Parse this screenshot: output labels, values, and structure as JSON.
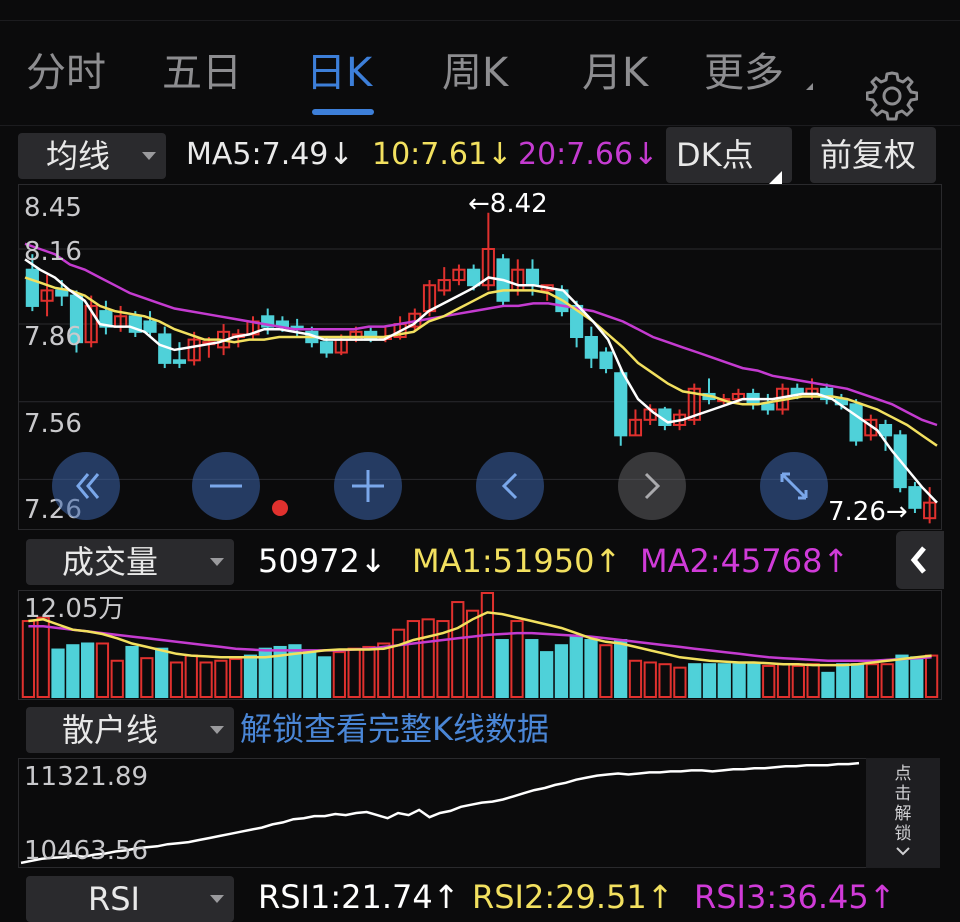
{
  "tabs": [
    {
      "label": "分时"
    },
    {
      "label": "五日"
    },
    {
      "label": "日K"
    },
    {
      "label": "周K"
    },
    {
      "label": "月K"
    },
    {
      "label": "更多"
    }
  ],
  "active_tab": "日K",
  "kline_header": {
    "indicator_dropdown": "均线",
    "ma5": "MA5:7.49↓",
    "ma10": "10:7.61↓",
    "ma20": "20:7.66↓",
    "dk_button": "DK点",
    "adjust_button": "前复权"
  },
  "kline_axis": [
    "8.45",
    "8.16",
    "7.86",
    "7.56",
    "7.26"
  ],
  "kline_annotations": {
    "high": "←8.42",
    "low": "7.26→"
  },
  "volume_header": {
    "indicator_dropdown": "成交量",
    "value": "50972↓",
    "ma1": "MA1:51950↑",
    "ma2": "MA2:45768↑"
  },
  "volume_axis_top": "12.05万",
  "retail_header": {
    "indicator_dropdown": "散户线",
    "unlock_link": "解锁查看完整K线数据"
  },
  "retail_axis": [
    "11321.89",
    "10463.56"
  ],
  "side_unlock": [
    "点",
    "击",
    "解",
    "锁"
  ],
  "rsi_header": {
    "indicator_dropdown": "RSI",
    "rsi1": "RSI1:21.74↑",
    "rsi2": "RSI2:29.51↑",
    "rsi3": "RSI3:36.45↑"
  },
  "colors": {
    "up": "#e0312e",
    "down": "#4fd1d9",
    "ma5": "#ffffff",
    "ma10": "#f2e05f",
    "ma20": "#c43bd0",
    "accent": "#3d7fd9"
  },
  "chart_data": [
    {
      "type": "candlestick",
      "ylim": [
        7.26,
        8.45
      ],
      "candles": [
        [
          8.2,
          8.06,
          8.26,
          8.04
        ],
        [
          8.08,
          8.12,
          8.18,
          8.02
        ],
        [
          8.12,
          8.1,
          8.16,
          8.06
        ],
        [
          8.1,
          7.92,
          8.12,
          7.88
        ],
        [
          7.92,
          8.06,
          8.1,
          7.9
        ],
        [
          8.04,
          7.98,
          8.08,
          7.95
        ],
        [
          7.98,
          8.02,
          8.06,
          7.96
        ],
        [
          8.02,
          7.96,
          8.04,
          7.94
        ],
        [
          8.0,
          7.96,
          8.04,
          7.94
        ],
        [
          7.95,
          7.84,
          7.98,
          7.82
        ],
        [
          7.85,
          7.84,
          7.92,
          7.82
        ],
        [
          7.85,
          7.93,
          7.96,
          7.83
        ],
        [
          7.92,
          7.92,
          7.94,
          7.86
        ],
        [
          7.9,
          7.96,
          7.99,
          7.87
        ],
        [
          7.94,
          7.95,
          7.97,
          7.9
        ],
        [
          7.95,
          8.0,
          8.02,
          7.93
        ],
        [
          8.02,
          7.98,
          8.05,
          7.95
        ],
        [
          8.0,
          7.98,
          8.02,
          7.96
        ],
        [
          7.98,
          7.97,
          8.01,
          7.94
        ],
        [
          7.96,
          7.92,
          7.98,
          7.9
        ],
        [
          7.92,
          7.88,
          7.94,
          7.86
        ],
        [
          7.88,
          7.93,
          7.95,
          7.87
        ],
        [
          7.93,
          7.96,
          7.98,
          7.92
        ],
        [
          7.96,
          7.93,
          7.98,
          7.92
        ],
        [
          7.94,
          7.94,
          7.98,
          7.92
        ],
        [
          7.94,
          7.99,
          8.02,
          7.93
        ],
        [
          7.98,
          8.03,
          8.05,
          7.96
        ],
        [
          8.04,
          8.14,
          8.16,
          8.02
        ],
        [
          8.12,
          8.16,
          8.21,
          8.1
        ],
        [
          8.16,
          8.2,
          8.22,
          8.14
        ],
        [
          8.2,
          8.14,
          8.22,
          8.12
        ],
        [
          8.14,
          8.28,
          8.42,
          8.12
        ],
        [
          8.24,
          8.08,
          8.26,
          8.06
        ],
        [
          8.12,
          8.2,
          8.24,
          8.1
        ],
        [
          8.2,
          8.14,
          8.24,
          8.1
        ],
        [
          8.12,
          8.14,
          8.14,
          8.08
        ],
        [
          8.12,
          8.04,
          8.14,
          8.02
        ],
        [
          8.06,
          7.94,
          8.08,
          7.9
        ],
        [
          7.94,
          7.86,
          7.98,
          7.82
        ],
        [
          7.88,
          7.82,
          7.9,
          7.8
        ],
        [
          7.8,
          7.56,
          7.82,
          7.52
        ],
        [
          7.56,
          7.62,
          7.66,
          7.56
        ],
        [
          7.62,
          7.66,
          7.68,
          7.6
        ],
        [
          7.66,
          7.6,
          7.67,
          7.58
        ],
        [
          7.6,
          7.64,
          7.66,
          7.58
        ],
        [
          7.62,
          7.74,
          7.76,
          7.6
        ],
        [
          7.72,
          7.7,
          7.78,
          7.68
        ],
        [
          7.7,
          7.7,
          7.72,
          7.68
        ],
        [
          7.7,
          7.72,
          7.74,
          7.68
        ],
        [
          7.72,
          7.68,
          7.74,
          7.66
        ],
        [
          7.68,
          7.66,
          7.72,
          7.64
        ],
        [
          7.66,
          7.74,
          7.76,
          7.64
        ],
        [
          7.74,
          7.72,
          7.76,
          7.7
        ],
        [
          7.72,
          7.74,
          7.78,
          7.7
        ],
        [
          7.74,
          7.7,
          7.76,
          7.68
        ],
        [
          7.7,
          7.68,
          7.72,
          7.66
        ],
        [
          7.68,
          7.54,
          7.7,
          7.52
        ],
        [
          7.56,
          7.62,
          7.64,
          7.54
        ],
        [
          7.6,
          7.56,
          7.62,
          7.5
        ],
        [
          7.56,
          7.36,
          7.58,
          7.34
        ],
        [
          7.36,
          7.28,
          7.38,
          7.26
        ],
        [
          7.24,
          7.3,
          7.36,
          7.22
        ]
      ],
      "ma5": [
        8.24,
        8.2,
        8.17,
        8.12,
        8.08,
        7.99,
        7.98,
        7.98,
        7.96,
        7.91,
        7.89,
        7.9,
        7.91,
        7.92,
        7.94,
        7.95,
        7.97,
        7.97,
        7.96,
        7.95,
        7.93,
        7.93,
        7.93,
        7.93,
        7.93,
        7.96,
        7.99,
        8.04,
        8.07,
        8.1,
        8.13,
        8.17,
        8.16,
        8.14,
        8.14,
        8.13,
        8.12,
        8.06,
        8.0,
        7.93,
        7.8,
        7.7,
        7.65,
        7.61,
        7.62,
        7.64,
        7.66,
        7.68,
        7.7,
        7.7,
        7.7,
        7.71,
        7.72,
        7.72,
        7.7,
        7.66,
        7.62,
        7.58,
        7.5,
        7.43,
        7.36,
        7.3
      ],
      "ma10": [
        8.17,
        8.15,
        8.13,
        8.12,
        8.1,
        8.06,
        8.04,
        8.03,
        8.02,
        8.0,
        7.97,
        7.95,
        7.93,
        7.93,
        7.92,
        7.93,
        7.93,
        7.94,
        7.94,
        7.94,
        7.94,
        7.94,
        7.94,
        7.94,
        7.94,
        7.95,
        7.96,
        8.0,
        8.02,
        8.05,
        8.08,
        8.11,
        8.12,
        8.12,
        8.12,
        8.11,
        8.08,
        8.04,
        8.0,
        7.95,
        7.9,
        7.84,
        7.8,
        7.76,
        7.73,
        7.72,
        7.71,
        7.69,
        7.68,
        7.68,
        7.69,
        7.7,
        7.71,
        7.71,
        7.71,
        7.7,
        7.68,
        7.66,
        7.63,
        7.6,
        7.56,
        7.52
      ],
      "ma20": [
        8.3,
        8.28,
        8.26,
        8.22,
        8.2,
        8.17,
        8.14,
        8.11,
        8.09,
        8.07,
        8.05,
        8.04,
        8.03,
        8.02,
        8.01,
        8.0,
        7.99,
        7.98,
        7.97,
        7.97,
        7.97,
        7.97,
        7.97,
        7.98,
        7.98,
        7.99,
        8.0,
        8.01,
        8.02,
        8.03,
        8.04,
        8.05,
        8.06,
        8.06,
        8.07,
        8.07,
        8.06,
        8.05,
        8.04,
        8.02,
        8.0,
        7.97,
        7.94,
        7.92,
        7.9,
        7.88,
        7.86,
        7.84,
        7.82,
        7.81,
        7.79,
        7.78,
        7.77,
        7.76,
        7.75,
        7.74,
        7.72,
        7.7,
        7.68,
        7.65,
        7.62,
        7.6
      ]
    },
    {
      "type": "bar",
      "ylim": [
        0,
        120500
      ],
      "volume_colors": [
        "up",
        "up",
        "down",
        "down",
        "down",
        "up",
        "up",
        "down",
        "up",
        "down",
        "up",
        "up",
        "up",
        "up",
        "up",
        "down",
        "down",
        "down",
        "down",
        "down",
        "down",
        "up",
        "up",
        "up",
        "up",
        "up",
        "up",
        "up",
        "up",
        "up",
        "up",
        "up",
        "down",
        "up",
        "down",
        "down",
        "down",
        "down",
        "down",
        "up",
        "down",
        "up",
        "up",
        "up",
        "up",
        "down",
        "down",
        "down",
        "down",
        "down",
        "up",
        "up",
        "up",
        "up",
        "down",
        "down",
        "down",
        "up",
        "up",
        "down",
        "down",
        "up"
      ],
      "volumes": [
        88000,
        92000,
        55000,
        60000,
        62000,
        62000,
        42000,
        58000,
        45000,
        56000,
        40000,
        48000,
        40000,
        42000,
        44000,
        48000,
        56000,
        58000,
        60000,
        52000,
        46000,
        52000,
        56000,
        58000,
        62000,
        78000,
        88000,
        90000,
        88000,
        110000,
        100000,
        120500,
        66000,
        88000,
        66000,
        52000,
        60000,
        70000,
        66000,
        60000,
        66000,
        42000,
        40000,
        38000,
        34000,
        38000,
        38000,
        38000,
        38000,
        38000,
        36000,
        38000,
        36000,
        38000,
        28000,
        38000,
        38000,
        38000,
        38000,
        48000,
        46000,
        48000
      ],
      "ma1": [
        88000,
        90000,
        84000,
        78000,
        76000,
        73000,
        68000,
        62000,
        58000,
        54000,
        50000,
        48000,
        47000,
        46000,
        46000,
        46000,
        46000,
        48000,
        50000,
        52000,
        54000,
        55000,
        55000,
        55000,
        56000,
        60000,
        66000,
        70000,
        74000,
        80000,
        90000,
        98000,
        96000,
        92000,
        88000,
        84000,
        80000,
        74000,
        68000,
        64000,
        62000,
        58000,
        54000,
        50000,
        46000,
        44000,
        42000,
        41000,
        40000,
        40000,
        39000,
        38000,
        38000,
        37000,
        37000,
        37000,
        38000,
        40000,
        42000,
        44000,
        46000,
        48000
      ],
      "ma2": [
        82000,
        82000,
        80000,
        78000,
        76000,
        74000,
        72000,
        70000,
        68000,
        66000,
        64000,
        62000,
        60000,
        58000,
        56000,
        55000,
        54000,
        54000,
        54000,
        54000,
        54000,
        54000,
        55000,
        56000,
        58000,
        60000,
        62000,
        64000,
        66000,
        68000,
        70000,
        72000,
        73000,
        74000,
        74000,
        73000,
        72000,
        71000,
        70000,
        68000,
        66000,
        64000,
        62000,
        60000,
        58000,
        56000,
        54000,
        52000,
        50000,
        48000,
        46000,
        45000,
        44000,
        43000,
        42000,
        42000,
        42000,
        42000,
        43000,
        44000,
        45000,
        46000
      ]
    },
    {
      "type": "line",
      "ylim": [
        10463.56,
        11321.89
      ],
      "y": [
        10420,
        10440,
        10460,
        10470,
        10475,
        10490,
        10480,
        10500,
        10510,
        10530,
        10540,
        10560,
        10570,
        10580,
        10600,
        10610,
        10620,
        10640,
        10660,
        10680,
        10700,
        10720,
        10740,
        10760,
        10790,
        10810,
        10840,
        10850,
        10870,
        10870,
        10890,
        10880,
        10900,
        10910,
        10880,
        10850,
        10900,
        10880,
        10930,
        10860,
        10900,
        10920,
        10960,
        10980,
        11000,
        11010,
        11030,
        11060,
        11090,
        11120,
        11140,
        11170,
        11190,
        11220,
        11240,
        11260,
        11270,
        11280,
        11270,
        11280,
        11290,
        11290,
        11300,
        11300,
        11310,
        11310,
        11300,
        11310,
        11320,
        11320,
        11330,
        11330,
        11340,
        11350,
        11350,
        11360,
        11360,
        11360,
        11370,
        11370,
        11380
      ]
    }
  ]
}
